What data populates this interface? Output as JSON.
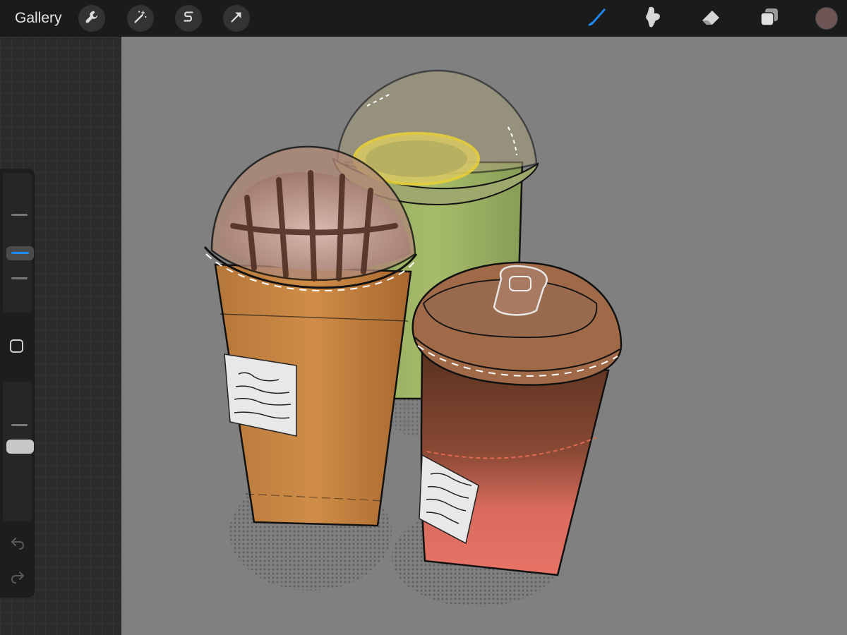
{
  "topbar": {
    "gallery_label": "Gallery",
    "left_tools": [
      "wrench-icon",
      "magic-wand-icon",
      "selection-s-icon",
      "transform-arrow-icon"
    ],
    "right_tools": [
      "brush-icon",
      "smudge-icon",
      "eraser-icon",
      "layers-icon"
    ],
    "active_tool": "brush-icon",
    "accent_color": "#1d8cf8",
    "current_color": "#6e5656"
  },
  "sidebar": {
    "brush_size_level": 0.6,
    "brush_opacity_level": 0.55,
    "controls": [
      "modify-button",
      "undo-icon",
      "redo-icon"
    ]
  },
  "canvas": {
    "background_color": "#808080",
    "artwork": "drink-cups-illustration",
    "labels": {
      "cup_left": [
        "~",
        "~~~~~",
        "~~~ ~~",
        "~~~~~ ~~~"
      ],
      "cup_right": [
        "~",
        "~~~~~",
        "~~~~~",
        "~~ ~~"
      ]
    }
  }
}
